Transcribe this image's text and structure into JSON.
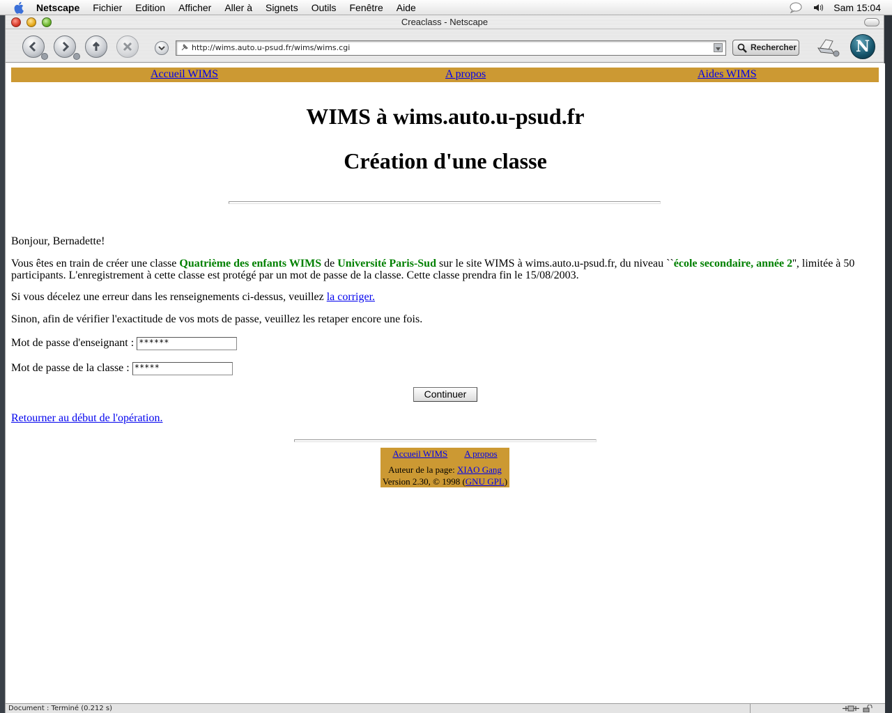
{
  "menubar": {
    "app_name": "Netscape",
    "items": [
      "Fichier",
      "Edition",
      "Afficher",
      "Aller à",
      "Signets",
      "Outils",
      "Fenêtre",
      "Aide"
    ],
    "clock": "Sam 15:04"
  },
  "window": {
    "title": "Creaclass - Netscape"
  },
  "toolbar": {
    "url": "http://wims.auto.u-psud.fr/wims/wims.cgi",
    "search_label": "Rechercher"
  },
  "page": {
    "top_links": [
      "Accueil WIMS",
      "A propos",
      "Aides WIMS"
    ],
    "title1": "WIMS à wims.auto.u-psud.fr",
    "title2": "Création d'une classe",
    "greeting": "Bonjour, Bernadette!",
    "para1": {
      "a": "Vous êtes en train de créer une classe ",
      "class_name": "Quatrième des enfants WIMS",
      "b": " de ",
      "institution": "Université Paris-Sud",
      "c": " sur le site WIMS à wims.auto.u-psud.fr, du niveau ``",
      "level": "école secondaire, année 2",
      "d": "'', limitée à 50 participants. L'enregistrement à cette classe est protégé par un mot de passe de la classe. Cette classe prendra fin le 15/08/2003."
    },
    "para2": {
      "a": "Si vous décelez une erreur dans les renseignements ci-dessus, veuillez ",
      "link": "la corriger."
    },
    "para3": "Sinon, afin de vérifier l'exactitude de vos mots de passe, veuillez les retaper encore une fois.",
    "teacher_pw_label": "Mot de passe d'enseignant :",
    "teacher_pw_value": "******",
    "class_pw_label": "Mot de passe de la classe :",
    "class_pw_value": "*****",
    "continue_label": "Continuer",
    "back_link": "Retourner au début de l'opération.",
    "footer": {
      "link_home": "Accueil WIMS",
      "link_about": "A propos",
      "author_prefix": "Auteur de la page: ",
      "author_link": "XIAO Gang",
      "version_prefix": "Version 2.30, © 1998 (",
      "license_link": "GNU GPL",
      "version_suffix": ")"
    }
  },
  "status": {
    "text": "Document : Terminé (0.212 s)"
  }
}
